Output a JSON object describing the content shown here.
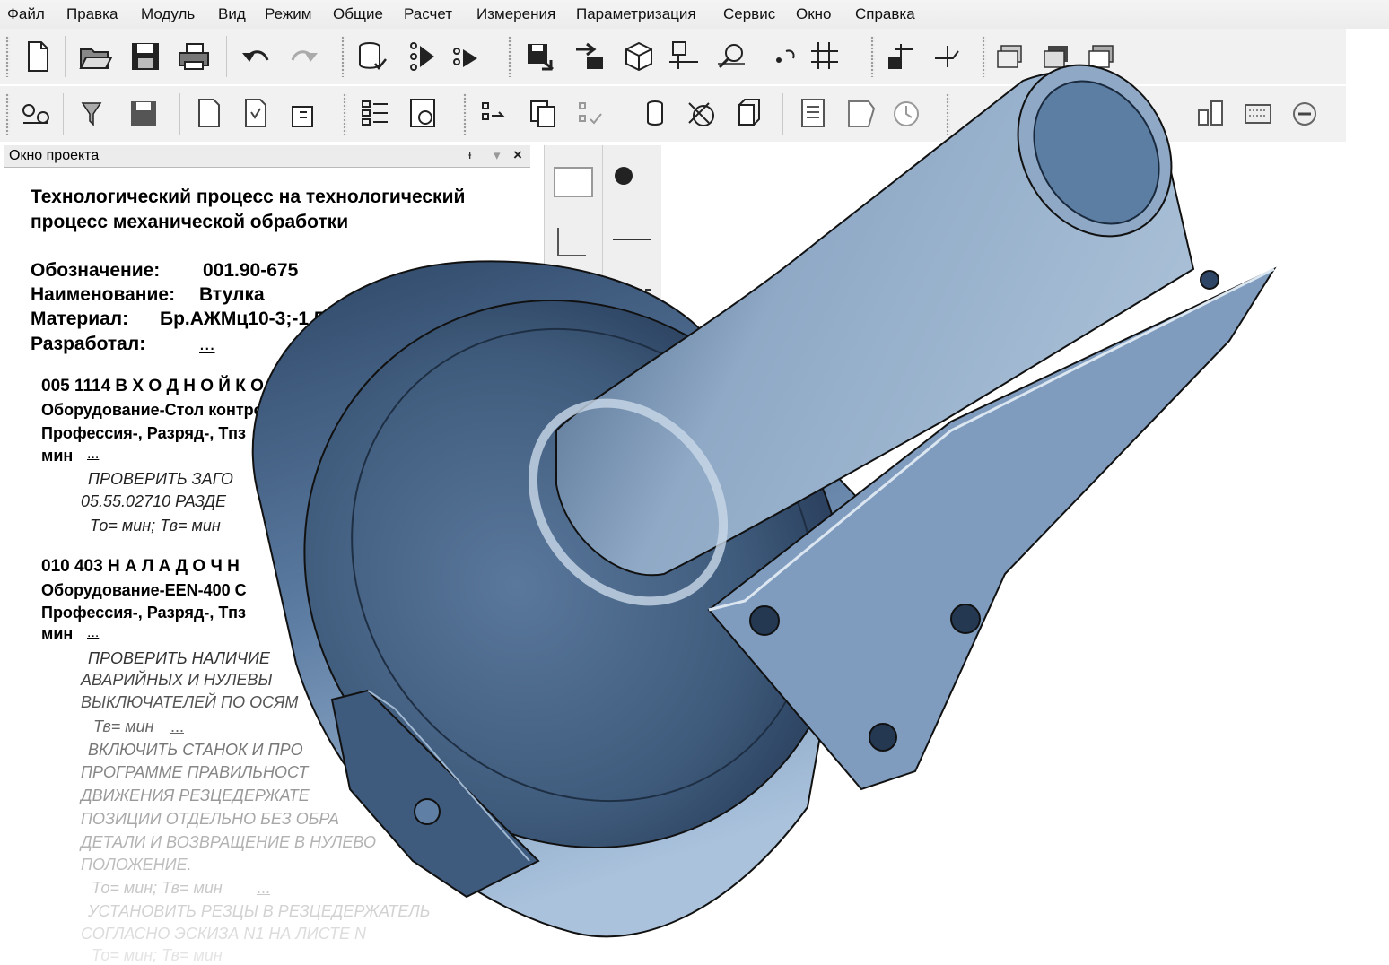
{
  "menu": [
    "Файл",
    "Правка",
    "Модуль",
    "Вид",
    "Режим",
    "Общие",
    "Расчет",
    "Измерения",
    "Параметризация",
    "Сервис",
    "Окно",
    "Справка"
  ],
  "toolbar1_icons": [
    "new-document-icon",
    "open-folder-icon",
    "save-icon",
    "print-icon",
    "undo-icon",
    "redo-icon",
    "database-check-icon",
    "view-mode-icon",
    "view-mode2-icon",
    "export-icon",
    "transfer-icon",
    "cube-icon",
    "axes-icon",
    "zoom-view-icon",
    "rotate-icon",
    "grid-icon",
    "section-icon",
    "section2-icon",
    "layers-icon",
    "layers2-icon",
    "layers3-icon",
    "plane-icon",
    "plane-grid-icon",
    "move-axis-icon",
    "axis-icon"
  ],
  "toolbar2_icons": [
    "link-icon",
    "filter-icon",
    "save-as-icon",
    "document-edit-icon",
    "document-view-icon",
    "document-settings-icon",
    "structure-icon",
    "preview-icon",
    "list-icon",
    "copy-icon",
    "checklist-icon",
    "cylinder-icon",
    "cancel-tool-icon",
    "cube-outline-icon",
    "text-document-icon",
    "shape-icon",
    "clock-icon",
    "table-icon",
    "panel-icon",
    "calculator-icon",
    "minus-icon"
  ],
  "project_window": {
    "title": "Окно проекта",
    "pin": "ᵻ",
    "dropdown": "▾",
    "close": "×"
  },
  "document": {
    "title_line1": "Технологический процесс на технологический",
    "title_line2": "процесс механической обработки",
    "designation_label": "Обозначение:",
    "designation_value": "001.90-675",
    "name_label": "Наименование:",
    "name_value": "Втулка",
    "material_label": "Материал:",
    "material_value": "Бр.АЖМц10-3;-1,5 ГОСТ",
    "developer_label": "Разработал:",
    "developer_value": "...",
    "op1_header": "005   1114 В Х О Д Н О Й  К О Н",
    "op1_equipment": "Оборудование-Стол контро",
    "op1_profession": "Профессия-, Разряд-, Тпз",
    "op1_min": "мин",
    "op1_min_link": "...",
    "op1_text1": "ПРОВЕРИТЬ ЗАГО",
    "op1_text2": "05.55.02710 РАЗДЕ",
    "op1_time": "То= мин;  Тв= мин",
    "op2_header": "010 403    Н А Л А Д О Ч Н",
    "op2_equipment": "Оборудование-EEN-400 С",
    "op2_profession": "Профессия-, Разряд-, Тпз",
    "op2_min": "мин",
    "op2_min_link": "...",
    "op2_text1": "ПРОВЕРИТЬ НАЛИЧИЕ",
    "op2_text2": "АВАРИЙНЫХ И НУЛЕВЫ",
    "op2_text3": "ВЫКЛЮЧАТЕЛЕЙ ПО ОСЯМ",
    "op2_time1": "Тв= мин",
    "op2_time1_link": "...",
    "op2_text4": "ВКЛЮЧИТЬ СТАНОК И ПРО",
    "op2_text5": "ПРОГРАММЕ ПРАВИЛЬНОСТ",
    "op2_text6": "ДВИЖЕНИЯ РЕЗЦЕДЕРЖАТЕ",
    "op2_text7": "ПОЗИЦИИ ОТДЕЛЬНО БЕЗ ОБРА",
    "op2_text8": "ДЕТАЛИ И ВОЗВРАЩЕНИЕ В НУЛЕВО",
    "op2_text9": "ПОЛОЖЕНИЕ.",
    "op2_time2": "То= мин;  Тв= мин",
    "op2_time2_link": "...",
    "op2_text10": "УСТАНОВИТЬ РЕЗЦЫ В РЕЗЦЕДЕРЖАТЕЛЬ",
    "op2_text11": "СОГЛАСНО ЭСКИЗА N1  НА ЛИСТЕ N",
    "op2_time3": "То= мин; Тв= мин"
  },
  "colors": {
    "part_light": "#a9c0d8",
    "part_mid": "#6f8db0",
    "part_dark": "#2e4560"
  }
}
